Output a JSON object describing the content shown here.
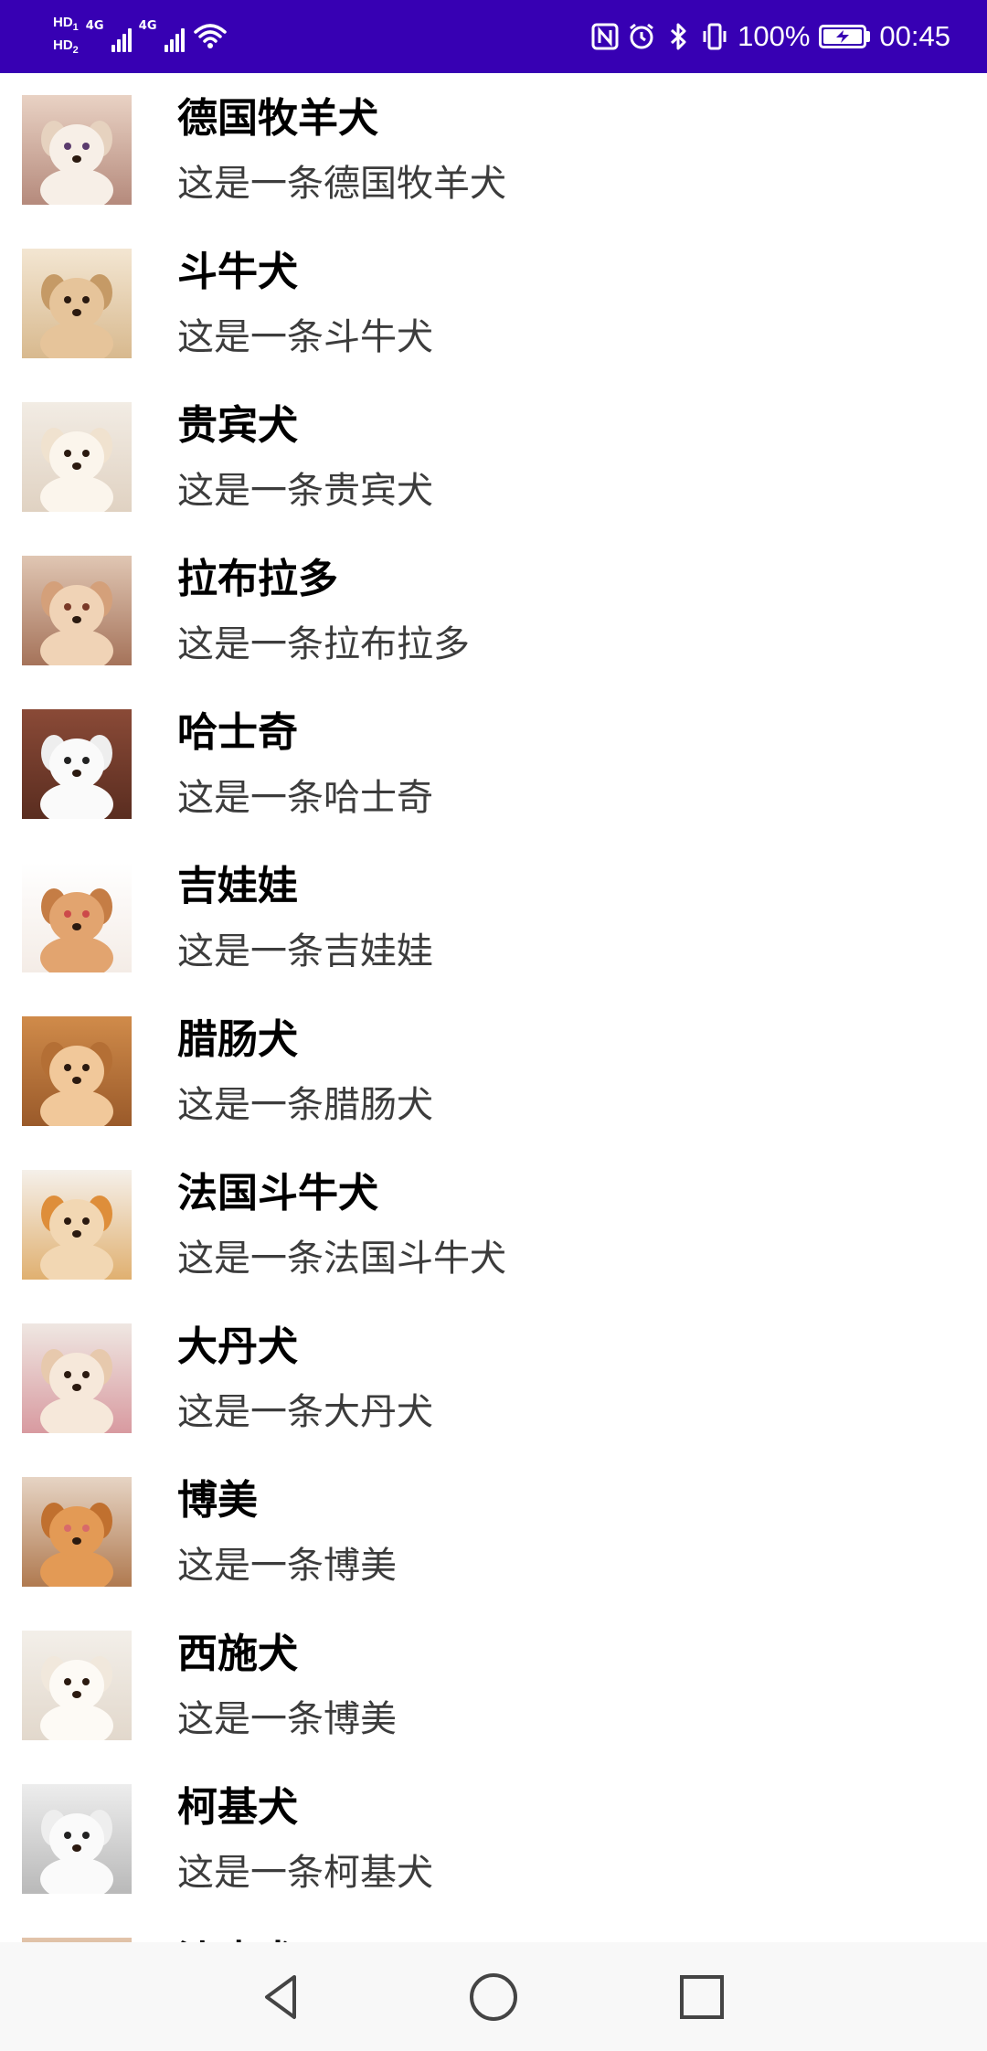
{
  "status_bar": {
    "hd1": "HD",
    "hd1_sub": "1",
    "hd2": "HD",
    "hd2_sub": "2",
    "net1": "4G",
    "net2": "4G",
    "battery_percent": "100%",
    "time": "00:45",
    "icons": [
      "nfc-icon",
      "alarm-icon",
      "bluetooth-icon",
      "vibrate-icon",
      "battery-charging-icon"
    ]
  },
  "colors": {
    "status_bar": "#3700b3",
    "title": "#000000",
    "description": "#3c3c3c",
    "nav_bar": "#f8f8f8"
  },
  "dogs": [
    {
      "title": "德国牧羊犬",
      "desc": "这是一条德国牧羊犬"
    },
    {
      "title": "斗牛犬",
      "desc": "这是一条斗牛犬"
    },
    {
      "title": "贵宾犬",
      "desc": "这是一条贵宾犬"
    },
    {
      "title": "拉布拉多",
      "desc": "这是一条拉布拉多"
    },
    {
      "title": "哈士奇",
      "desc": "这是一条哈士奇"
    },
    {
      "title": "吉娃娃",
      "desc": "这是一条吉娃娃"
    },
    {
      "title": "腊肠犬",
      "desc": "这是一条腊肠犬"
    },
    {
      "title": "法国斗牛犬",
      "desc": "这是一条法国斗牛犬"
    },
    {
      "title": "大丹犬",
      "desc": "这是一条大丹犬"
    },
    {
      "title": "博美",
      "desc": "这是一条博美"
    },
    {
      "title": "西施犬",
      "desc": "这是一条博美"
    },
    {
      "title": "柯基犬",
      "desc": "这是一条柯基犬"
    },
    {
      "title": "沙皮犬",
      "desc": ""
    }
  ],
  "nav": {
    "icons": [
      "back-icon",
      "home-icon",
      "recents-icon"
    ]
  }
}
